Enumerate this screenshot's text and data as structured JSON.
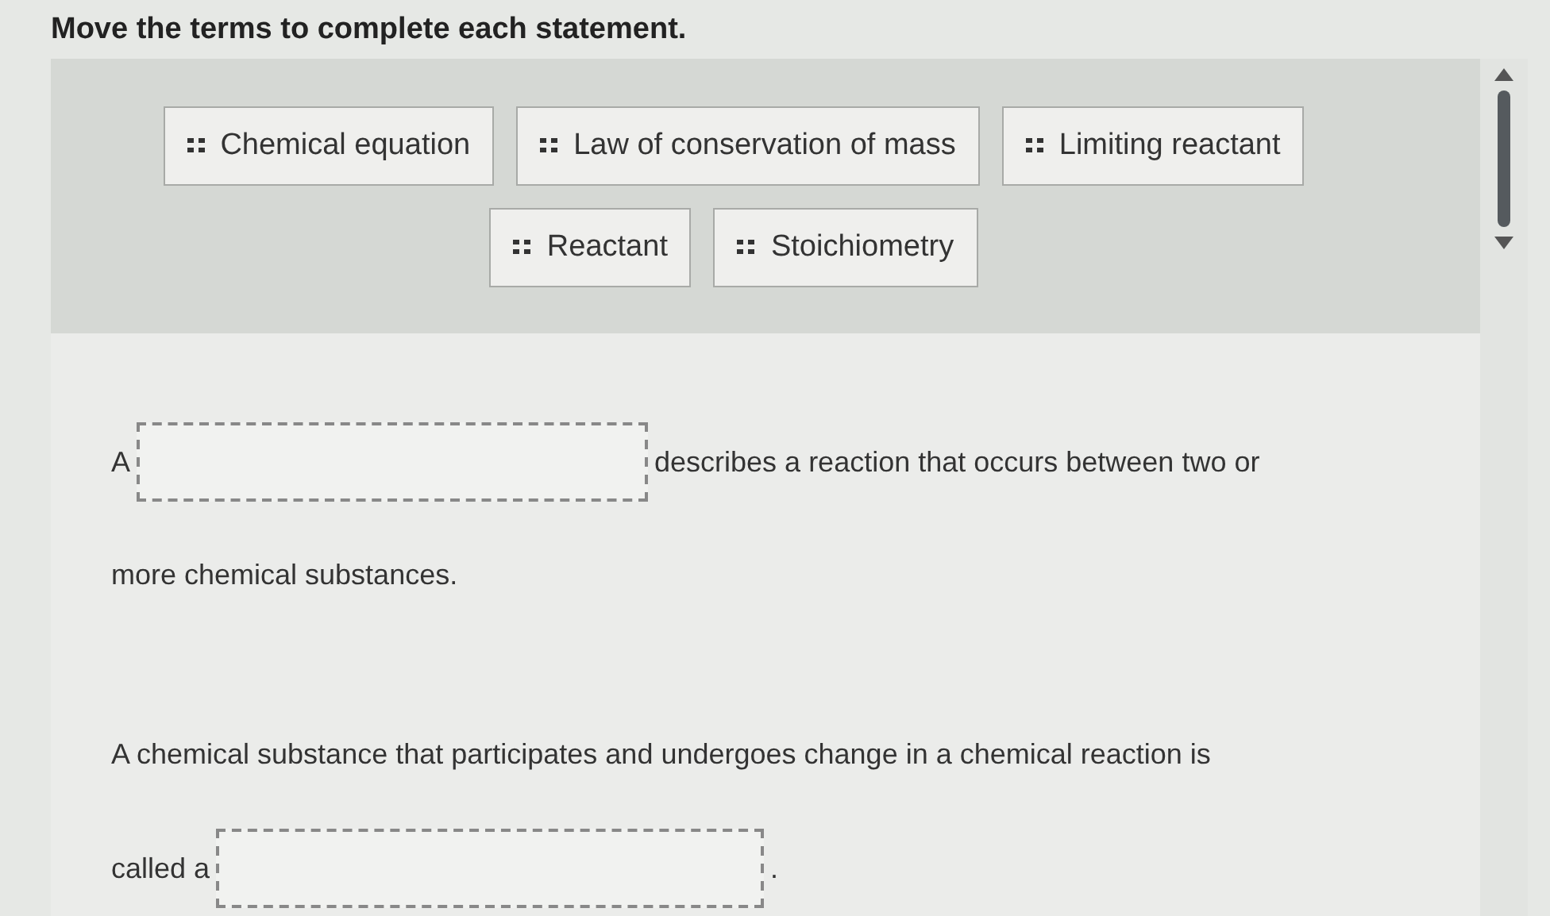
{
  "instruction": "Move the terms to complete each statement.",
  "terms": [
    {
      "label": "Chemical equation"
    },
    {
      "label": "Law of conservation of mass"
    },
    {
      "label": "Limiting reactant"
    },
    {
      "label": "Reactant"
    },
    {
      "label": "Stoichiometry"
    }
  ],
  "statements": [
    {
      "lines": [
        [
          {
            "kind": "text",
            "text": "A"
          },
          {
            "kind": "blank"
          },
          {
            "kind": "text",
            "text": "describes a reaction that occurs between two or"
          }
        ],
        [
          {
            "kind": "text",
            "text": "more chemical substances."
          }
        ]
      ]
    },
    {
      "lines": [
        [
          {
            "kind": "text",
            "text": "A chemical substance that participates and undergoes change in a chemical reaction is"
          }
        ],
        [
          {
            "kind": "text",
            "text": "called a"
          },
          {
            "kind": "blank"
          },
          {
            "kind": "text",
            "text": "."
          }
        ]
      ]
    }
  ]
}
